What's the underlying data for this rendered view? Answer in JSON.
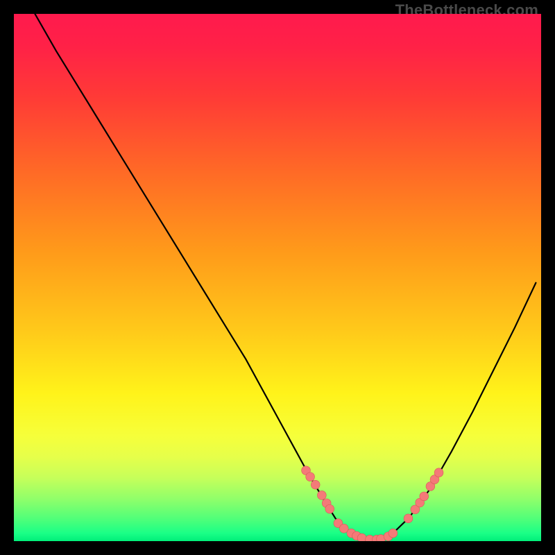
{
  "watermark": "TheBottleneck.com",
  "colors": {
    "frame": "#000000",
    "gradient_stops": [
      {
        "offset": 0.0,
        "color": "#ff1a4d"
      },
      {
        "offset": 0.06,
        "color": "#ff2147"
      },
      {
        "offset": 0.16,
        "color": "#ff3b36"
      },
      {
        "offset": 0.3,
        "color": "#ff6a26"
      },
      {
        "offset": 0.45,
        "color": "#ff9a1a"
      },
      {
        "offset": 0.6,
        "color": "#ffc91a"
      },
      {
        "offset": 0.72,
        "color": "#fff31a"
      },
      {
        "offset": 0.8,
        "color": "#f6ff3a"
      },
      {
        "offset": 0.84,
        "color": "#e6ff4a"
      },
      {
        "offset": 0.88,
        "color": "#c6ff5a"
      },
      {
        "offset": 0.92,
        "color": "#90ff6a"
      },
      {
        "offset": 0.96,
        "color": "#4cff7a"
      },
      {
        "offset": 0.985,
        "color": "#1aff86"
      },
      {
        "offset": 1.0,
        "color": "#00ef7a"
      }
    ],
    "curve": "#000000",
    "dot_fill": "#f47a78",
    "dot_stroke": "#d65a58"
  },
  "chart_data": {
    "type": "line",
    "title": "",
    "xlabel": "",
    "ylabel": "",
    "xlim": [
      0,
      100
    ],
    "ylim": [
      0,
      100
    ],
    "grid": false,
    "series": [
      {
        "name": "bottleneck-curve",
        "x": [
          4,
          8,
          12,
          16,
          20,
          24,
          28,
          32,
          36,
          40,
          44,
          47,
          50,
          53,
          56,
          59,
          61,
          62.5,
          64,
          66,
          68,
          70,
          72,
          75,
          79,
          83,
          87,
          91,
          95,
          99
        ],
        "y": [
          100,
          93,
          86.5,
          80,
          73.5,
          67,
          60.5,
          54,
          47.5,
          41,
          34.5,
          29,
          23.5,
          18,
          12.5,
          7.5,
          4.3,
          2.7,
          1.6,
          0.7,
          0.3,
          0.5,
          1.6,
          4.5,
          10,
          17,
          24.5,
          32.5,
          40.5,
          49
        ]
      }
    ],
    "markers": {
      "name": "highlight-dots",
      "points": [
        {
          "x": 55.4,
          "y": 13.4
        },
        {
          "x": 56.2,
          "y": 12.2
        },
        {
          "x": 57.2,
          "y": 10.7
        },
        {
          "x": 58.4,
          "y": 8.7
        },
        {
          "x": 59.3,
          "y": 7.2
        },
        {
          "x": 59.9,
          "y": 6.1
        },
        {
          "x": 61.5,
          "y": 3.4
        },
        {
          "x": 62.6,
          "y": 2.4
        },
        {
          "x": 64.0,
          "y": 1.5
        },
        {
          "x": 65.0,
          "y": 1.0
        },
        {
          "x": 66.0,
          "y": 0.6
        },
        {
          "x": 67.5,
          "y": 0.3
        },
        {
          "x": 68.8,
          "y": 0.3
        },
        {
          "x": 69.6,
          "y": 0.4
        },
        {
          "x": 71.0,
          "y": 0.9
        },
        {
          "x": 71.9,
          "y": 1.5
        },
        {
          "x": 74.8,
          "y": 4.3
        },
        {
          "x": 76.1,
          "y": 6.0
        },
        {
          "x": 77.0,
          "y": 7.3
        },
        {
          "x": 77.8,
          "y": 8.5
        },
        {
          "x": 79.0,
          "y": 10.4
        },
        {
          "x": 79.8,
          "y": 11.7
        },
        {
          "x": 80.6,
          "y": 13.0
        }
      ]
    }
  }
}
